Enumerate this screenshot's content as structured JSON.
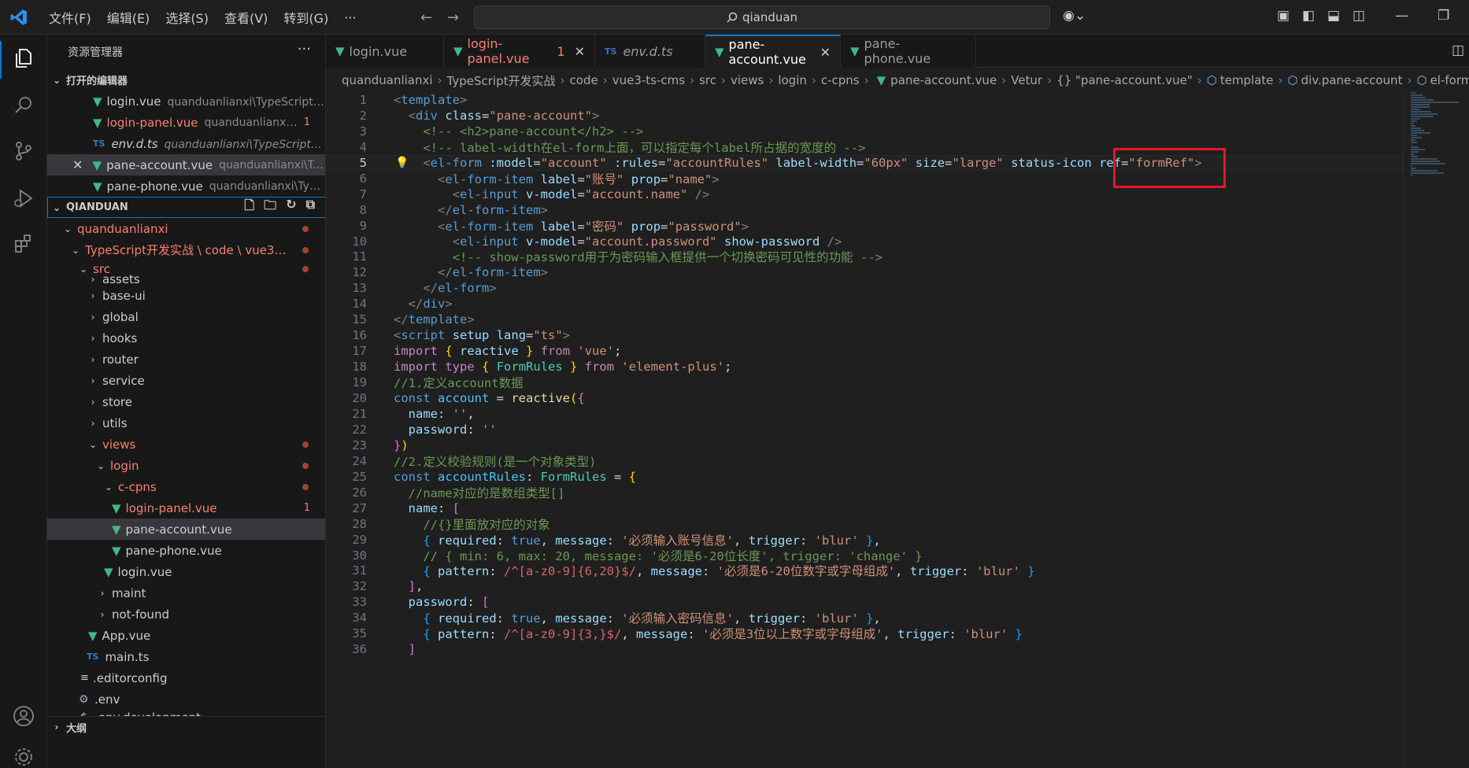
{
  "titlebar": {
    "menus": [
      "文件(F)",
      "编辑(E)",
      "选择(S)",
      "查看(V)",
      "转到(G)",
      "···"
    ],
    "search": "qianduan"
  },
  "sidebar": {
    "title": "资源管理器",
    "more": "···",
    "open_editors_header": "打开的编辑器",
    "open_editors": [
      {
        "name": "login.vue",
        "desc": "quanduanlianxi\\TypeScript开...",
        "icon": "vue",
        "badge": ""
      },
      {
        "name": "login-panel.vue",
        "desc": "quanduanlianxi\\...",
        "icon": "vue",
        "badge": "1"
      },
      {
        "name": "env.d.ts",
        "desc": "quanduanlianxi\\TypeScript开发...",
        "icon": "ts",
        "badge": ""
      },
      {
        "name": "pane-account.vue",
        "desc": "quanduanlianxi\\Ty...",
        "icon": "vue",
        "badge": ""
      },
      {
        "name": "pane-phone.vue",
        "desc": "quanduanlianxi\\Type...",
        "icon": "vue",
        "badge": ""
      }
    ],
    "workspace_header": "QIANDUAN",
    "tree": {
      "root": "quanduanlianxi",
      "path": "TypeScript开发实战 \\ code \\ vue3-t...",
      "src": "src",
      "folders": [
        "assets",
        "base-ui",
        "global",
        "hooks",
        "router",
        "service",
        "store",
        "utils"
      ],
      "views": "views",
      "login": "login",
      "c_cpns": "c-cpns",
      "cpns_files": [
        "login-panel.vue",
        "pane-account.vue",
        "pane-phone.vue"
      ],
      "cpns_badge": "1",
      "login_vue": "login.vue",
      "more_folders": [
        "maint",
        "not-found"
      ],
      "root_files": [
        "App.vue",
        "main.ts"
      ],
      "dot_files": [
        ".editorconfig",
        ".env",
        ".env.development"
      ]
    },
    "outline_header": "大纲"
  },
  "tabs": [
    {
      "label": "login.vue",
      "icon": "vue",
      "modified": false,
      "active": false,
      "badge": ""
    },
    {
      "label": "login-panel.vue",
      "icon": "vue",
      "modified": true,
      "active": false,
      "badge": "1"
    },
    {
      "label": "env.d.ts",
      "icon": "ts",
      "modified": false,
      "active": false,
      "badge": ""
    },
    {
      "label": "pane-account.vue",
      "icon": "vue",
      "modified": false,
      "active": true,
      "badge": ""
    },
    {
      "label": "pane-phone.vue",
      "icon": "vue",
      "modified": false,
      "active": false,
      "badge": ""
    }
  ],
  "breadcrumb": [
    "quanduanlianxi",
    "TypeScript开发实战",
    "code",
    "vue3-ts-cms",
    "src",
    "views",
    "login",
    "c-cpns",
    "pane-account.vue",
    "Vetur",
    "{} \"pane-account.vue\"",
    "template",
    "div.pane-account",
    "el-form"
  ],
  "editor": {
    "current_line": 5,
    "lines": [
      [
        [
          "t-gr",
          "<"
        ],
        [
          "t-tag",
          "template"
        ],
        [
          "t-gr",
          ">"
        ]
      ],
      [
        [
          "t-pl",
          "  "
        ],
        [
          "t-gr",
          "<"
        ],
        [
          "t-tag",
          "div"
        ],
        [
          "t-pl",
          " "
        ],
        [
          "t-attr",
          "class"
        ],
        [
          "t-pl",
          "="
        ],
        [
          "t-str",
          "\"pane-account\""
        ],
        [
          "t-gr",
          ">"
        ]
      ],
      [
        [
          "t-pl",
          "    "
        ],
        [
          "t-cmt",
          "<!-- <h2>pane-account</h2> -->"
        ]
      ],
      [
        [
          "t-pl",
          "    "
        ],
        [
          "t-cmt",
          "<!-- label-width在el-form上面，可以指定每个label所占据的宽度的 -->"
        ]
      ],
      [
        [
          "t-pl",
          "    "
        ],
        [
          "t-gr",
          "<"
        ],
        [
          "t-tag",
          "el-form"
        ],
        [
          "t-pl",
          " "
        ],
        [
          "t-attr",
          ":model"
        ],
        [
          "t-pl",
          "="
        ],
        [
          "t-str",
          "\"account\""
        ],
        [
          "t-pl",
          " "
        ],
        [
          "t-attr",
          ":rules"
        ],
        [
          "t-pl",
          "="
        ],
        [
          "t-str",
          "\"accountRules\""
        ],
        [
          "t-pl",
          " "
        ],
        [
          "t-attr",
          "label-width"
        ],
        [
          "t-pl",
          "="
        ],
        [
          "t-str",
          "\"60px\""
        ],
        [
          "t-pl",
          " "
        ],
        [
          "t-attr",
          "size"
        ],
        [
          "t-pl",
          "="
        ],
        [
          "t-str",
          "\"large\""
        ],
        [
          "t-pl",
          " "
        ],
        [
          "t-attr",
          "status-icon"
        ],
        [
          "t-pl",
          " "
        ],
        [
          "t-attr",
          "ref"
        ],
        [
          "t-pl",
          "="
        ],
        [
          "t-str",
          "\"formRef\""
        ],
        [
          "t-gr",
          ">"
        ]
      ],
      [
        [
          "t-pl",
          "      "
        ],
        [
          "t-gr",
          "<"
        ],
        [
          "t-tag",
          "el-form-item"
        ],
        [
          "t-pl",
          " "
        ],
        [
          "t-attr",
          "label"
        ],
        [
          "t-pl",
          "="
        ],
        [
          "t-str",
          "\"账号\""
        ],
        [
          "t-pl",
          " "
        ],
        [
          "t-attr",
          "prop"
        ],
        [
          "t-pl",
          "="
        ],
        [
          "t-str",
          "\"name\""
        ],
        [
          "t-gr",
          ">"
        ]
      ],
      [
        [
          "t-pl",
          "        "
        ],
        [
          "t-gr",
          "<"
        ],
        [
          "t-tag",
          "el-input"
        ],
        [
          "t-pl",
          " "
        ],
        [
          "t-attr",
          "v-model"
        ],
        [
          "t-pl",
          "="
        ],
        [
          "t-str",
          "\"account.name\""
        ],
        [
          "t-pl",
          " "
        ],
        [
          "t-gr",
          "/>"
        ]
      ],
      [
        [
          "t-pl",
          "      "
        ],
        [
          "t-gr",
          "</"
        ],
        [
          "t-tag",
          "el-form-item"
        ],
        [
          "t-gr",
          ">"
        ]
      ],
      [
        [
          "t-pl",
          "      "
        ],
        [
          "t-gr",
          "<"
        ],
        [
          "t-tag",
          "el-form-item"
        ],
        [
          "t-pl",
          " "
        ],
        [
          "t-attr",
          "label"
        ],
        [
          "t-pl",
          "="
        ],
        [
          "t-str",
          "\"密码\""
        ],
        [
          "t-pl",
          " "
        ],
        [
          "t-attr",
          "prop"
        ],
        [
          "t-pl",
          "="
        ],
        [
          "t-str",
          "\"password\""
        ],
        [
          "t-gr",
          ">"
        ]
      ],
      [
        [
          "t-pl",
          "        "
        ],
        [
          "t-gr",
          "<"
        ],
        [
          "t-tag",
          "el-input"
        ],
        [
          "t-pl",
          " "
        ],
        [
          "t-attr",
          "v-model"
        ],
        [
          "t-pl",
          "="
        ],
        [
          "t-str",
          "\"account.password\""
        ],
        [
          "t-pl",
          " "
        ],
        [
          "t-attr",
          "show-password"
        ],
        [
          "t-pl",
          " "
        ],
        [
          "t-gr",
          "/>"
        ]
      ],
      [
        [
          "t-pl",
          "        "
        ],
        [
          "t-cmt",
          "<!-- show-password用于为密码输入框提供一个切换密码可见性的功能 -->"
        ]
      ],
      [
        [
          "t-pl",
          "      "
        ],
        [
          "t-gr",
          "</"
        ],
        [
          "t-tag",
          "el-form-item"
        ],
        [
          "t-gr",
          ">"
        ]
      ],
      [
        [
          "t-pl",
          "    "
        ],
        [
          "t-gr",
          "</"
        ],
        [
          "t-tag",
          "el-form"
        ],
        [
          "t-gr",
          ">"
        ]
      ],
      [
        [
          "t-pl",
          "  "
        ],
        [
          "t-gr",
          "</"
        ],
        [
          "t-tag",
          "div"
        ],
        [
          "t-gr",
          ">"
        ]
      ],
      [
        [
          "t-gr",
          "</"
        ],
        [
          "t-tag",
          "template"
        ],
        [
          "t-gr",
          ">"
        ]
      ],
      [
        [
          "t-gr",
          "<"
        ],
        [
          "t-tag",
          "script"
        ],
        [
          "t-pl",
          " "
        ],
        [
          "t-attr",
          "setup"
        ],
        [
          "t-pl",
          " "
        ],
        [
          "t-attr",
          "lang"
        ],
        [
          "t-pl",
          "="
        ],
        [
          "t-str",
          "\"ts\""
        ],
        [
          "t-gr",
          ">"
        ]
      ],
      [
        [
          "t-kw",
          "import"
        ],
        [
          "t-pl",
          " "
        ],
        [
          "t-br1",
          "{"
        ],
        [
          "t-pl",
          " "
        ],
        [
          "t-prop",
          "reactive"
        ],
        [
          "t-pl",
          " "
        ],
        [
          "t-br1",
          "}"
        ],
        [
          "t-pl",
          " "
        ],
        [
          "t-kw",
          "from"
        ],
        [
          "t-pl",
          " "
        ],
        [
          "t-str",
          "'vue'"
        ],
        [
          "t-pl",
          ";"
        ]
      ],
      [
        [
          "t-kw",
          "import"
        ],
        [
          "t-pl",
          " "
        ],
        [
          "t-kw",
          "type"
        ],
        [
          "t-pl",
          " "
        ],
        [
          "t-br1",
          "{"
        ],
        [
          "t-pl",
          " "
        ],
        [
          "t-type",
          "FormRules"
        ],
        [
          "t-pl",
          " "
        ],
        [
          "t-br1",
          "}"
        ],
        [
          "t-pl",
          " "
        ],
        [
          "t-kw",
          "from"
        ],
        [
          "t-pl",
          " "
        ],
        [
          "t-str",
          "'element-plus'"
        ],
        [
          "t-pl",
          ";"
        ]
      ],
      [
        [
          "t-cmt",
          "//1.定义account数据"
        ]
      ],
      [
        [
          "t-kw2",
          "const"
        ],
        [
          "t-pl",
          " "
        ],
        [
          "t-var",
          "account"
        ],
        [
          "t-pl",
          " = "
        ],
        [
          "t-fn",
          "reactive"
        ],
        [
          "t-br1",
          "("
        ],
        [
          "t-br2",
          "{"
        ]
      ],
      [
        [
          "t-pl",
          "  "
        ],
        [
          "t-prop",
          "name"
        ],
        [
          "t-pl",
          ": "
        ],
        [
          "t-str",
          "''"
        ],
        [
          "t-pl",
          ","
        ]
      ],
      [
        [
          "t-pl",
          "  "
        ],
        [
          "t-prop",
          "password"
        ],
        [
          "t-pl",
          ": "
        ],
        [
          "t-str",
          "''"
        ]
      ],
      [
        [
          "t-br2",
          "}"
        ],
        [
          "t-br1",
          ")"
        ]
      ],
      [
        [
          "t-cmt",
          "//2.定义校验规则(是一个对象类型)"
        ]
      ],
      [
        [
          "t-kw2",
          "const"
        ],
        [
          "t-pl",
          " "
        ],
        [
          "t-var",
          "accountRules"
        ],
        [
          "t-pl",
          ": "
        ],
        [
          "t-type",
          "FormRules"
        ],
        [
          "t-pl",
          " = "
        ],
        [
          "t-br1",
          "{"
        ]
      ],
      [
        [
          "t-pl",
          "  "
        ],
        [
          "t-cmt",
          "//name对应的是数组类型[]"
        ]
      ],
      [
        [
          "t-pl",
          "  "
        ],
        [
          "t-prop",
          "name"
        ],
        [
          "t-pl",
          ": "
        ],
        [
          "t-br2",
          "["
        ]
      ],
      [
        [
          "t-pl",
          "    "
        ],
        [
          "t-cmt",
          "//{}里面放对应的对象"
        ]
      ],
      [
        [
          "t-pl",
          "    "
        ],
        [
          "t-br3",
          "{"
        ],
        [
          "t-pl",
          " "
        ],
        [
          "t-prop",
          "required"
        ],
        [
          "t-pl",
          ": "
        ],
        [
          "t-kw2",
          "true"
        ],
        [
          "t-pl",
          ", "
        ],
        [
          "t-prop",
          "message"
        ],
        [
          "t-pl",
          ": "
        ],
        [
          "t-str",
          "'必须输入账号信息'"
        ],
        [
          "t-pl",
          ", "
        ],
        [
          "t-prop",
          "trigger"
        ],
        [
          "t-pl",
          ": "
        ],
        [
          "t-str",
          "'blur'"
        ],
        [
          "t-pl",
          " "
        ],
        [
          "t-br3",
          "}"
        ],
        [
          "t-pl",
          ","
        ]
      ],
      [
        [
          "t-pl",
          "    "
        ],
        [
          "t-cmt",
          "// { min: 6, max: 20, message: '必须是6-20位长度', trigger: 'change' }"
        ]
      ],
      [
        [
          "t-pl",
          "    "
        ],
        [
          "t-br3",
          "{"
        ],
        [
          "t-pl",
          " "
        ],
        [
          "t-prop",
          "pattern"
        ],
        [
          "t-pl",
          ": "
        ],
        [
          "t-rx",
          "/^[a-z0-9]{6,20}$/"
        ],
        [
          "t-pl",
          ", "
        ],
        [
          "t-prop",
          "message"
        ],
        [
          "t-pl",
          ": "
        ],
        [
          "t-str",
          "'必须是6-20位数字或字母组成'"
        ],
        [
          "t-pl",
          ", "
        ],
        [
          "t-prop",
          "trigger"
        ],
        [
          "t-pl",
          ": "
        ],
        [
          "t-str",
          "'blur'"
        ],
        [
          "t-pl",
          " "
        ],
        [
          "t-br3",
          "}"
        ]
      ],
      [
        [
          "t-pl",
          "  "
        ],
        [
          "t-br2",
          "]"
        ],
        [
          "t-pl",
          ","
        ]
      ],
      [
        [
          "t-pl",
          "  "
        ],
        [
          "t-prop",
          "password"
        ],
        [
          "t-pl",
          ": "
        ],
        [
          "t-br2",
          "["
        ]
      ],
      [
        [
          "t-pl",
          "    "
        ],
        [
          "t-br3",
          "{"
        ],
        [
          "t-pl",
          " "
        ],
        [
          "t-prop",
          "required"
        ],
        [
          "t-pl",
          ": "
        ],
        [
          "t-kw2",
          "true"
        ],
        [
          "t-pl",
          ", "
        ],
        [
          "t-prop",
          "message"
        ],
        [
          "t-pl",
          ": "
        ],
        [
          "t-str",
          "'必须输入密码信息'"
        ],
        [
          "t-pl",
          ", "
        ],
        [
          "t-prop",
          "trigger"
        ],
        [
          "t-pl",
          ": "
        ],
        [
          "t-str",
          "'blur'"
        ],
        [
          "t-pl",
          " "
        ],
        [
          "t-br3",
          "}"
        ],
        [
          "t-pl",
          ","
        ]
      ],
      [
        [
          "t-pl",
          "    "
        ],
        [
          "t-br3",
          "{"
        ],
        [
          "t-pl",
          " "
        ],
        [
          "t-prop",
          "pattern"
        ],
        [
          "t-pl",
          ": "
        ],
        [
          "t-rx",
          "/^[a-z0-9]{3,}$/"
        ],
        [
          "t-pl",
          ", "
        ],
        [
          "t-prop",
          "message"
        ],
        [
          "t-pl",
          ": "
        ],
        [
          "t-str",
          "'必须是3位以上数字或字母组成'"
        ],
        [
          "t-pl",
          ", "
        ],
        [
          "t-prop",
          "trigger"
        ],
        [
          "t-pl",
          ": "
        ],
        [
          "t-str",
          "'blur'"
        ],
        [
          "t-pl",
          " "
        ],
        [
          "t-br3",
          "}"
        ]
      ],
      [
        [
          "t-pl",
          "  "
        ],
        [
          "t-br2",
          "]"
        ]
      ]
    ]
  },
  "colors": {
    "accent": "#0078d4",
    "annotation_box": "#e8152b",
    "vue_icon": "#42b883",
    "ts_icon": "#3178c6",
    "modified": "#f88070"
  }
}
